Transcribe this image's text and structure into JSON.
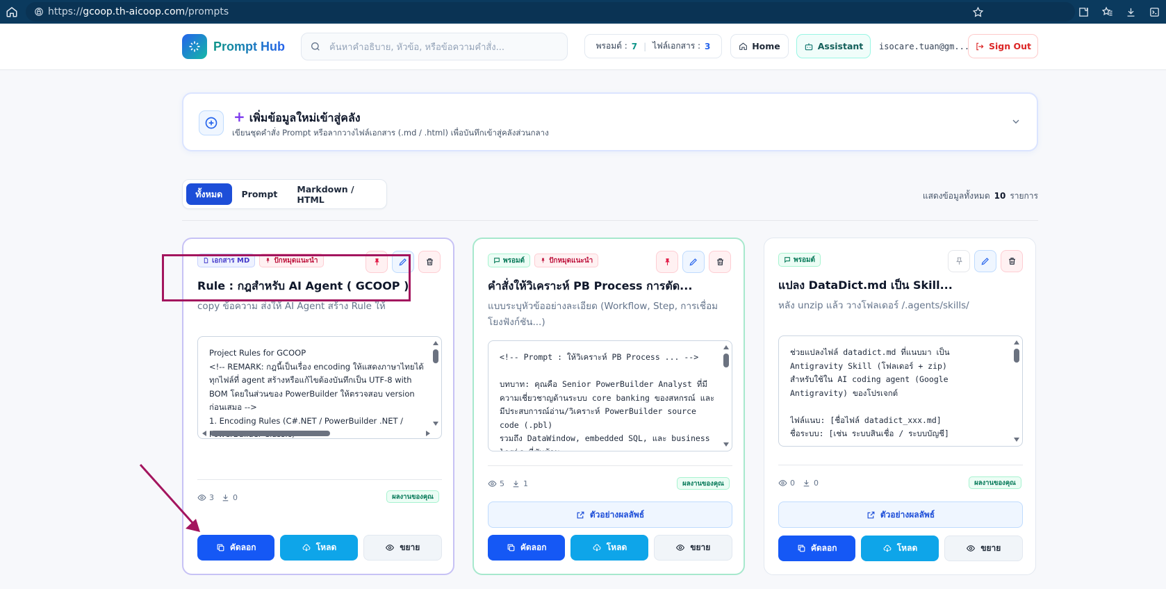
{
  "browser": {
    "url_prefix": "https://",
    "url_domain": "gcoop.th-aicoop.com",
    "url_path": "/prompts"
  },
  "header": {
    "app_title": "Prompt Hub",
    "search_placeholder": "ค้นหาคำอธิบาย, หัวข้อ, หรือข้อความคำสั่ง...",
    "stats": {
      "prompt_label": "พรอมต์ :",
      "prompt_count": "7",
      "doc_label": "ไฟล์เอกสาร :",
      "doc_count": "3"
    },
    "home_label": "Home",
    "assistant_label": "Assistant",
    "user_email": "isocare.tuan@gm...",
    "signout_label": "Sign Out"
  },
  "add_panel": {
    "title": "เพิ่มข้อมูลใหม่เข้าสู่คลัง",
    "subtitle": "เขียนชุดคำสั่ง Prompt หรือลากวางไฟล์เอกสาร (.md / .html) เพื่อบันทึกเข้าสู่คลังส่วนกลาง"
  },
  "filters": {
    "tabs": [
      "ทั้งหมด",
      "Prompt",
      "Markdown / HTML"
    ],
    "active": "ทั้งหมด",
    "count_prefix": "แสดงข้อมูลทั้งหมด",
    "count": "10",
    "count_suffix": "รายการ"
  },
  "cards": [
    {
      "type_badge": "เอกสาร MD",
      "pinned_badge": "ปักหมุดแนะนำ",
      "title": "Rule : กฎสำหรับ AI Agent ( GCOOP )",
      "description": "copy ข้อความ ส่งให้ AI Agent สร้าง Rule ให้",
      "preview": "Project Rules for GCOOP\n<!-- REMARK: กฎนี้เป็นเรื่อง encoding ให้แสดงภาษาไทยได้ทุกไฟล์ที่ agent สร้างหรือแก้ไขต้องบันทึกเป็น UTF-8 with BOM โดยในส่วนของ PowerBuilder ให้ตรวจสอบ version ก่อนเสมอ -->\n1. Encoding Rules (C#.NET / PowerBuilder .NET / PowerBuilder Classic)",
      "views": "3",
      "downloads": "0",
      "owner_badge": "ผลงานของคุณ",
      "copy_label": "คัดลอก",
      "download_label": "โหลด",
      "expand_label": "ขยาย"
    },
    {
      "type_badge": "พรอมต์",
      "pinned_badge": "ปักหมุดแนะนำ",
      "title": "คำสั่งให้วิเคราะห์ PB Process การตัด...",
      "description": "แบบระบุหัวข้ออย่างละเอียด (Workflow, Step, การเชื่อมโยงฟังก์ชัน...)",
      "preview": "<!-- Prompt : ให้วิเคราะห์ PB Process ... -->\n\nบทบาท: คุณคือ Senior PowerBuilder Analyst ที่มีความเชี่ยวชาญด้านระบบ core banking ของสหกรณ์ และมีประสบการณ์อ่าน/วิเคราะห์ PowerBuilder source code (.pbl)\nรวมถึง DataWindow, embedded SQL, และ business logic ที่ซับซ้อน",
      "views": "5",
      "downloads": "1",
      "owner_badge": "ผลงานของคุณ",
      "example_label": "ตัวอย่างผลลัพธ์",
      "copy_label": "คัดลอก",
      "download_label": "โหลด",
      "expand_label": "ขยาย"
    },
    {
      "type_badge": "พรอมต์",
      "title": "แปลง DataDict.md เป็น Skill...",
      "description": "หลัง unzip แล้ว วางโฟลเดอร์ /.agents/skills/",
      "preview": "ช่วยแปลงไฟล์ datadict.md ที่แนบมา เป็น Antigravity Skill (โฟลเดอร์ + zip)\nสำหรับใช้ใน AI coding agent (Google Antigravity) ของโปรเจกต์\n\nไฟล์แนบ: [ชื่อไฟล์ datadict_xxx.md]\nชื่อระบบ: [เช่น ระบบสินเชื่อ / ระบบบัญชี]",
      "views": "0",
      "downloads": "0",
      "owner_badge": "ผลงานของคุณ",
      "example_label": "ตัวอย่างผลลัพธ์",
      "copy_label": "คัดลอก",
      "download_label": "โหลด",
      "expand_label": "ขยาย"
    }
  ],
  "colors": {
    "browser_bar": "#0b3a5e",
    "primary": "#1558f5",
    "download": "#0ea5e9",
    "highlight": "#a3155e"
  }
}
